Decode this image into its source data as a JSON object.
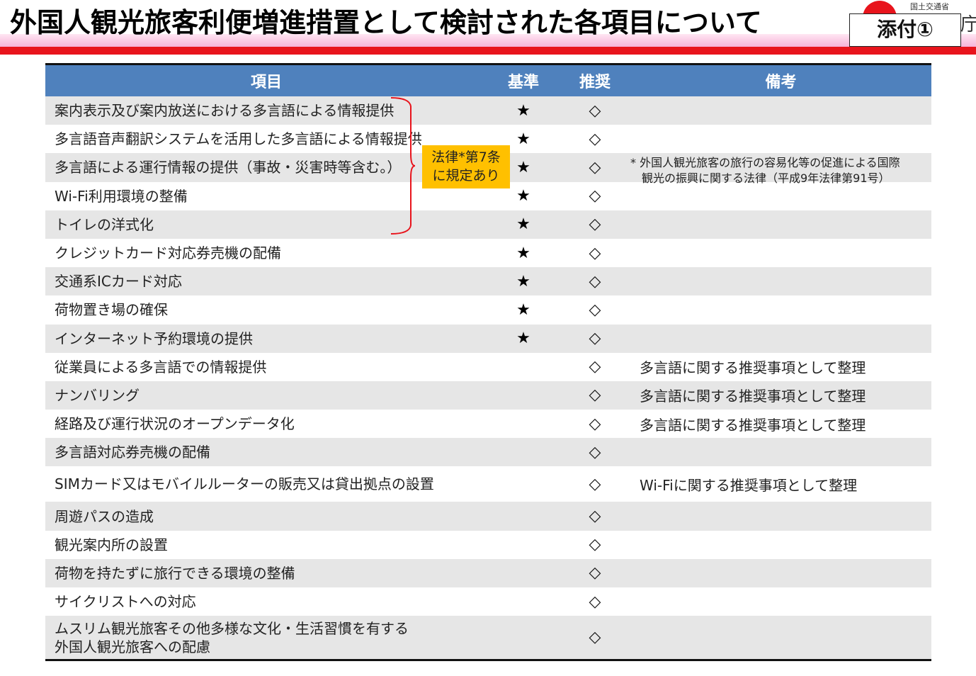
{
  "header": {
    "title": "外国人観光旅客利便増進措置として検討された各項目について",
    "attachment_label": "添付①",
    "logo_caption": "国土交通省",
    "logo_fragment": "庁"
  },
  "colors": {
    "header_blue": "#4f81bd",
    "title_red_band": "#e8141c",
    "badge_yellow": "#ffc000",
    "row_shade": "#e6e6e6"
  },
  "table": {
    "headers": {
      "item": "項目",
      "kijun": "基準",
      "suisho": "推奨",
      "biko": "備考"
    },
    "rows": [
      {
        "item": "案内表示及び案内放送における多言語による情報提供",
        "kijun": "★",
        "suisho": "◇",
        "biko": ""
      },
      {
        "item": "多言語音声翻訳システムを活用した多言語による情報提供",
        "kijun": "★",
        "suisho": "◇",
        "biko": ""
      },
      {
        "item": "多言語による運行情報の提供（事故・災害時等含む。）",
        "kijun": "★",
        "suisho": "◇",
        "biko": ""
      },
      {
        "item": "Wi-Fi利用環境の整備",
        "kijun": "★",
        "suisho": "◇",
        "biko": ""
      },
      {
        "item": "トイレの洋式化",
        "kijun": "★",
        "suisho": "◇",
        "biko": ""
      },
      {
        "item": "クレジットカード対応券売機の配備",
        "kijun": "★",
        "suisho": "◇",
        "biko": ""
      },
      {
        "item": "交通系ICカード対応",
        "kijun": "★",
        "suisho": "◇",
        "biko": ""
      },
      {
        "item": "荷物置き場の確保",
        "kijun": "★",
        "suisho": "◇",
        "biko": ""
      },
      {
        "item": "インターネット予約環境の提供",
        "kijun": "★",
        "suisho": "◇",
        "biko": ""
      },
      {
        "item": "従業員による多言語での情報提供",
        "kijun": "",
        "suisho": "◇",
        "biko": "多言語に関する推奨事項として整理"
      },
      {
        "item": "ナンバリング",
        "kijun": "",
        "suisho": "◇",
        "biko": "多言語に関する推奨事項として整理"
      },
      {
        "item": "経路及び運行状況のオープンデータ化",
        "kijun": "",
        "suisho": "◇",
        "biko": "多言語に関する推奨事項として整理"
      },
      {
        "item": "多言語対応券売機の配備",
        "kijun": "",
        "suisho": "◇",
        "biko": ""
      },
      {
        "item": "SIMカード又はモバイルルーターの販売又は貸出拠点の設置",
        "kijun": "",
        "suisho": "◇",
        "biko": "Wi-Fiに関する推奨事項として整理"
      },
      {
        "item": "周遊パスの造成",
        "kijun": "",
        "suisho": "◇",
        "biko": ""
      },
      {
        "item": "観光案内所の設置",
        "kijun": "",
        "suisho": "◇",
        "biko": ""
      },
      {
        "item": "荷物を持たずに旅行できる環境の整備",
        "kijun": "",
        "suisho": "◇",
        "biko": ""
      },
      {
        "item": "サイクリストへの対応",
        "kijun": "",
        "suisho": "◇",
        "biko": ""
      },
      {
        "item_line1": "ムスリム観光旅客その他多様な文化・生活習慣を有する",
        "item_line2": "外国人観光旅客への配慮",
        "kijun": "",
        "suisho": "◇",
        "biko": ""
      }
    ]
  },
  "annotation": {
    "law_badge_line1": "法律*第7条",
    "law_badge_line2": "に規定あり",
    "law_note_line1": "* 外国人観光旅客の旅行の容易化等の促進による国際",
    "law_note_line2": "観光の振興に関する法律（平成9年法律第91号）"
  }
}
